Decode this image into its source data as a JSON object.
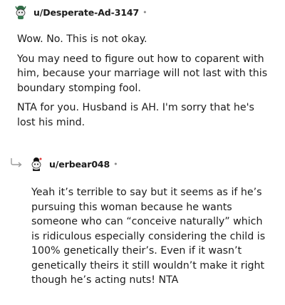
{
  "comment1": {
    "username": "u/Desperate-Ad-3147",
    "separator": "•",
    "avatar": "snoo-avatar-icon",
    "paragraphs": [
      "Wow. No. This is not okay.",
      "You may need to figure out how to coparent with him, because your marriage will not last with this boundary stomping fool.",
      "NTA for you. Husband is AH. I'm sorry that he's lost his mind."
    ]
  },
  "comment2": {
    "username": "u/erbear048",
    "separator": "•",
    "avatar": "snoo-avatar-icon",
    "reply_icon": "reply-arrow-icon",
    "text": "Yeah it’s terrible to say but it seems as if he’s pursuing this woman because he wants someone who can “conceive naturally” which is ridiculous especially considering the child is 100% genetically their’s. Even if it wasn’t genetically theirs it still wouldn’t make it right though he’s acting nuts! NTA"
  }
}
